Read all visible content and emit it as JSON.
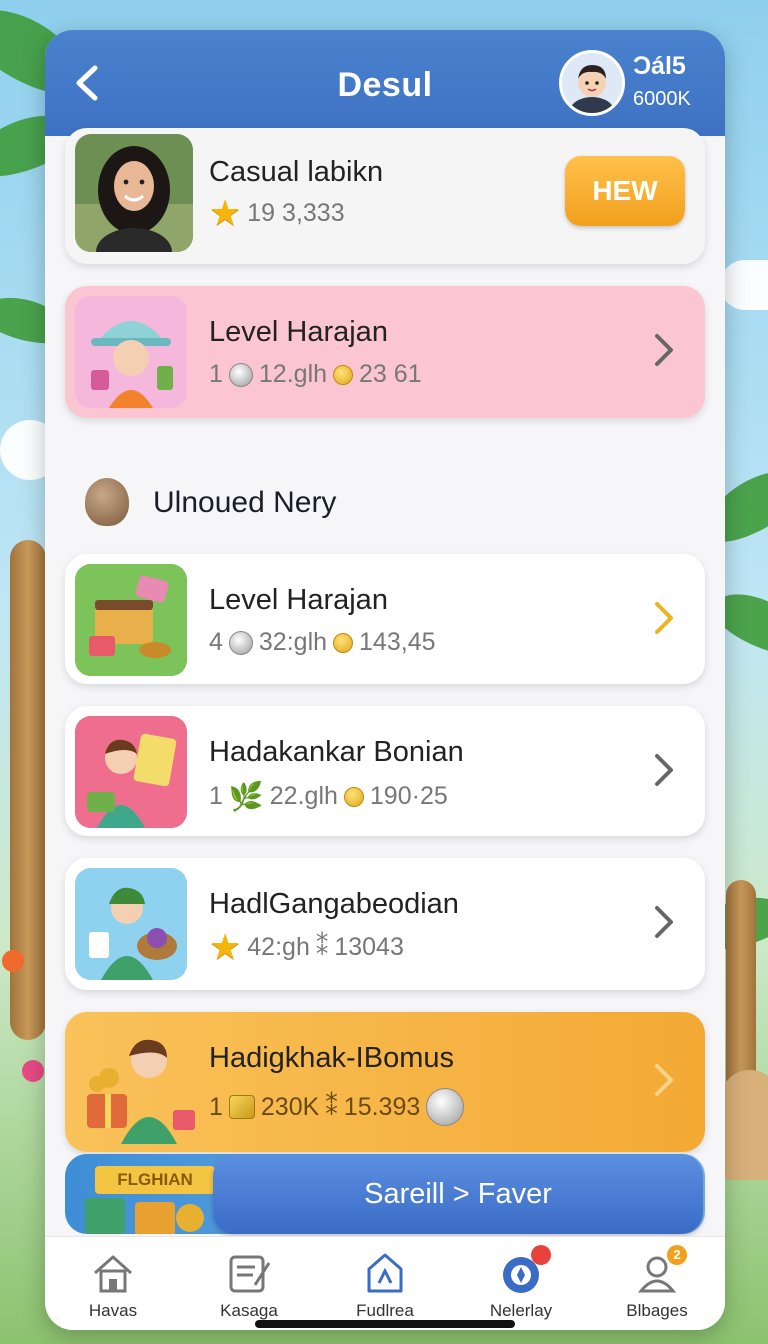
{
  "header": {
    "title": "Desul",
    "profile_name": "Ɔál5",
    "profile_coins": "6000K"
  },
  "cards": [
    {
      "title": "Casual labikn",
      "stat": "19 3,333",
      "badge_label": "HEW"
    },
    {
      "title": "Level Harajan",
      "stat_a": "1",
      "stat_b": "12.glh",
      "stat_c": "23 61"
    },
    {
      "title": "Level Harajan",
      "stat_a": "4",
      "stat_b": "32:glh",
      "stat_c": "143,45"
    },
    {
      "title": "Hadakankar Bonian",
      "stat_a": "1",
      "stat_b": "22.glh",
      "stat_c": "190·25"
    },
    {
      "title": "HadlGangabeodian",
      "stat_b": "42:gh",
      "stat_sep": "⁑",
      "stat_c": "13043"
    },
    {
      "title": "Hadigkhak-IBomus",
      "stat_a": "1",
      "stat_b": "230K",
      "stat_sep": "⁑",
      "stat_c": "15.393"
    }
  ],
  "section": {
    "title": "Ulnoued Nery"
  },
  "promo": {
    "banner": "FLGHIAN",
    "button_label": "Sareill > Faver"
  },
  "tabs": [
    {
      "label": "Havas",
      "icon": "home-icon"
    },
    {
      "label": "Kasaga",
      "icon": "note-icon"
    },
    {
      "label": "Fudlrea",
      "icon": "shop-icon"
    },
    {
      "label": "Nelerlay",
      "icon": "compass-icon"
    },
    {
      "label": "Blbages",
      "icon": "profile-icon",
      "badge": "2"
    }
  ],
  "colors": {
    "header": "#3d72c2",
    "accent_orange": "#f2a01d",
    "pink_card": "#fbc6d2",
    "gold_card": "#f7b54a",
    "button_blue": "#3a6cc6"
  }
}
